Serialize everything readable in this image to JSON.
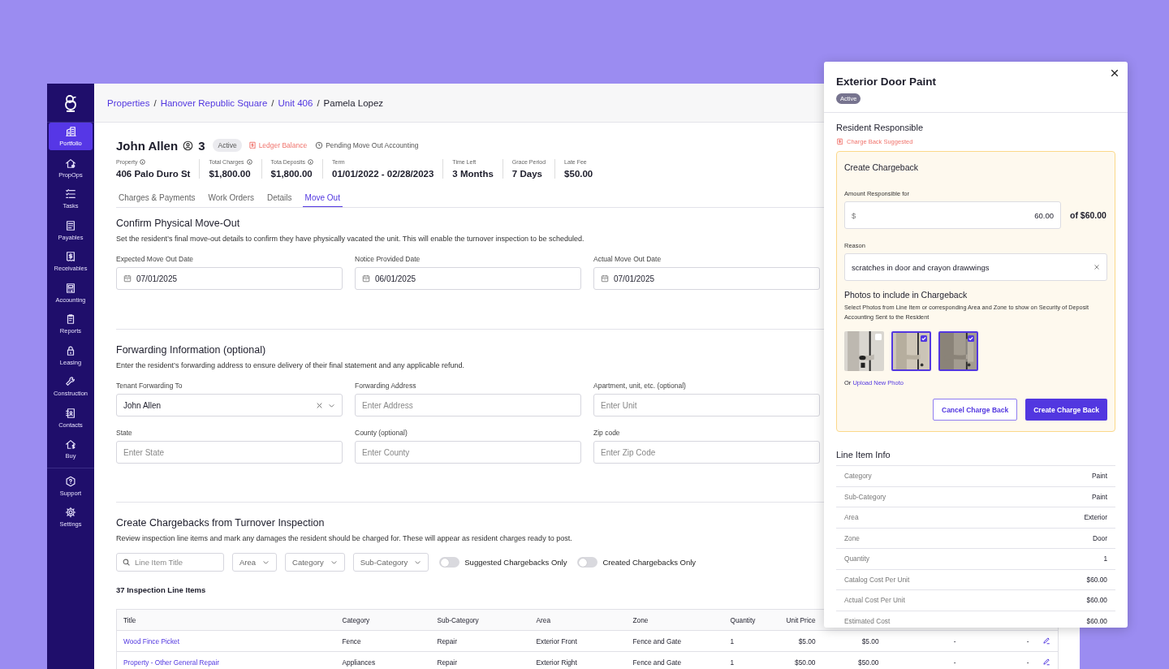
{
  "sidebar": {
    "items": [
      {
        "label": "Portfolio",
        "selected": true
      },
      {
        "label": "PropOps",
        "selected": false
      },
      {
        "label": "Tasks",
        "selected": false
      },
      {
        "label": "Payables",
        "selected": false
      },
      {
        "label": "Receivables",
        "selected": false
      },
      {
        "label": "Accounting",
        "selected": false
      },
      {
        "label": "Reports",
        "selected": false
      },
      {
        "label": "Leasing",
        "selected": false
      },
      {
        "label": "Construction",
        "selected": false
      },
      {
        "label": "Contacts",
        "selected": false
      },
      {
        "label": "Buy",
        "selected": false
      }
    ],
    "bottom_items": [
      {
        "label": "Support",
        "selected": false
      },
      {
        "label": "Settings",
        "selected": false
      }
    ]
  },
  "breadcrumb": [
    {
      "label": "Properties",
      "kind": "link"
    },
    {
      "label": "Hanover Republic Square",
      "kind": "link",
      "separator": "/"
    },
    {
      "label": "Unit 406",
      "kind": "link",
      "separator": "/"
    },
    {
      "label": "Pamela Lopez",
      "kind": "current",
      "separator": "/"
    }
  ],
  "resident": {
    "name": "John Allen",
    "occupants": "3",
    "status": "Active",
    "ledger": "Ledger Balance",
    "move_out_status": "Pending Move Out Accounting"
  },
  "stats": [
    {
      "label": "Property",
      "info": true,
      "value": "406 Palo Duro St"
    },
    {
      "label": "Total Charges",
      "info": true,
      "value": "$1,800.00"
    },
    {
      "label": "Tota Deposits",
      "info": true,
      "value": "$1,800.00"
    },
    {
      "label": "Term",
      "info": false,
      "value": "01/01/2022 - 02/28/2023"
    },
    {
      "label": "Time Left",
      "info": false,
      "value": "3 Months"
    },
    {
      "label": "Grace Period",
      "info": false,
      "value": "7 Days"
    },
    {
      "label": "Late Fee",
      "info": false,
      "value": "$50.00"
    }
  ],
  "tabs": [
    {
      "label": "Charges & Payments",
      "selected": false
    },
    {
      "label": "Work Orders",
      "selected": false
    },
    {
      "label": "Details",
      "selected": false
    },
    {
      "label": "Move Out",
      "selected": true
    }
  ],
  "move_out": {
    "title": "Confirm Physical Move-Out",
    "description": "Set the resident’s final move-out details to confirm they have physically vacated the unit. This will enable the turnover inspection to be scheduled.",
    "fields": [
      {
        "kind": "date",
        "label": "Expected Move Out Date",
        "value": "07/01/2025"
      },
      {
        "kind": "date",
        "label": "Notice Provided Date",
        "value": "06/01/2025"
      },
      {
        "kind": "date",
        "label": "Actual Move Out Date",
        "value": "07/01/2025"
      }
    ]
  },
  "forwarding": {
    "title": "Forwarding Information (optional)",
    "description": "Enter the resident’s forwarding address to ensure delivery of their final statement and any applicable refund.",
    "fields": [
      {
        "kind": "select",
        "label": "Tenant Forwarding To",
        "value": "John Allen"
      },
      {
        "kind": "text",
        "label": "Forwarding Address",
        "placeholder": "Enter Address"
      },
      {
        "kind": "text",
        "label": "Apartment, unit, etc. (optional)",
        "placeholder": "Enter Unit"
      },
      {
        "kind": "text",
        "label": "State",
        "placeholder": "Enter State"
      },
      {
        "kind": "text",
        "label": "County (optional)",
        "placeholder": "Enter County"
      },
      {
        "kind": "text",
        "label": "Zip code",
        "placeholder": "Enter Zip Code"
      }
    ]
  },
  "chargebacks": {
    "title": "Create Chargebacks from Turnover Inspection",
    "description": "Review inspection line items and mark any damages the resident should be charged for. These will appear as resident charges ready to post.",
    "search": {
      "placeholder": "Line Item Title"
    },
    "dropdowns": [
      "Area",
      "Category",
      "Sub-Category"
    ],
    "toggles": [
      {
        "label": "Suggested Chargebacks Only",
        "on": false
      },
      {
        "label": "Created Chargebacks Only",
        "on": false
      }
    ],
    "count": "37 Inspection Line Items",
    "table": {
      "columns": [
        "Title",
        "Category",
        "Sub-Category",
        "Area",
        "Zone",
        "Quantity",
        "Unit Price"
      ],
      "rows": [
        {
          "cells": [
            "Wood Fince Picket",
            "Fence",
            "Repair",
            "Exterior Front",
            "Fence and Gate",
            "1",
            "$5.00",
            "$5.00",
            "-",
            "-"
          ]
        },
        {
          "cells": [
            "Property - Other General Repair",
            "Appliances",
            "Repair",
            "Exterior Right",
            "Fence and Gate",
            "1",
            "$50.00",
            "$50.00",
            "-",
            "-"
          ]
        }
      ]
    }
  },
  "drawer": {
    "title": "Exterior Door Paint",
    "status": "Active",
    "section_title": "Resident Responsible",
    "suggestion": "Charge Back Suggested",
    "card": {
      "title": "Create Chargeback",
      "amount": {
        "label": "Amount Responsible for",
        "prefix": "$",
        "value": "60.00",
        "total": "of $60.00"
      },
      "reason": {
        "label": "Reason",
        "value": "scratches in door and crayon drawwings"
      },
      "photos": {
        "title": "Photos to include in Chargeback",
        "description": "Select Photos from Line Item or corresponding Area and Zone to show on Security of Deposit Accounting Sent to the Resident",
        "items": [
          {
            "kind": "picture",
            "checked": false
          },
          {
            "kind": "picture",
            "checked": true
          },
          {
            "kind": "picture",
            "checked": true
          }
        ],
        "upload_prefix": "Or",
        "upload_link": "Upload New Photo"
      },
      "buttons": [
        {
          "label": "Cancel Charge Back",
          "kind": "secondary"
        },
        {
          "label": "Create Charge Back",
          "kind": "primary"
        }
      ]
    },
    "info": {
      "title": "Line Item Info",
      "rows": [
        {
          "label": "Category",
          "value": "Paint"
        },
        {
          "label": "Sub-Category",
          "value": "Paint"
        },
        {
          "label": "Area",
          "value": "Exterior"
        },
        {
          "label": "Zone",
          "value": "Door"
        },
        {
          "label": "Quantity",
          "value": "1"
        },
        {
          "label": "Catalog Cost Per Unit",
          "value": "$60.00"
        },
        {
          "label": "Actual Cost Per Unit",
          "value": "$60.00"
        },
        {
          "label": "Estimated Cost",
          "value": "$60.00"
        }
      ]
    }
  }
}
